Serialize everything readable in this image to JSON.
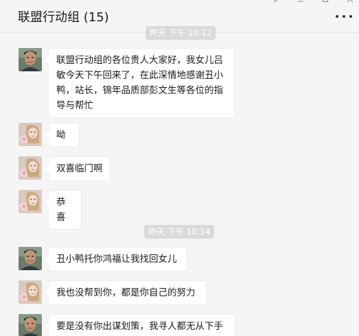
{
  "chat": {
    "title": "联盟行动组 (15)",
    "more_icon": "more-dots-icon",
    "window_controls": [
      "pin-icon",
      "minimize-icon",
      "maximize-icon",
      "close-icon"
    ]
  },
  "timestamps": {
    "first": "昨天 下午 10:12",
    "second": "昨天 下午 10:14"
  },
  "messages": [
    {
      "sender": "man",
      "text": "联盟行动组的各位贵人大家好，我女儿吕敏今天下午回来了，在此深情地感谢丑小鸭，站长，锦年品质部彭文生等各位的指导与帮忙"
    },
    {
      "sender": "woman",
      "text": "呦"
    },
    {
      "sender": "woman",
      "text": "双喜临门啊"
    },
    {
      "sender": "woman",
      "text": "恭喜"
    },
    {
      "sender": "man",
      "text": "丑小鸭托你鸿福让我找回女儿"
    },
    {
      "sender": "woman",
      "text": "我也没帮到你，都是你自己的努力"
    },
    {
      "sender": "man",
      "text": "要是没有你出谋划策，我寻人都无从下手"
    }
  ],
  "colors": {
    "background": "#f5f5f5",
    "bubble": "#ffffff",
    "timestamp_pill": "#dadada"
  }
}
